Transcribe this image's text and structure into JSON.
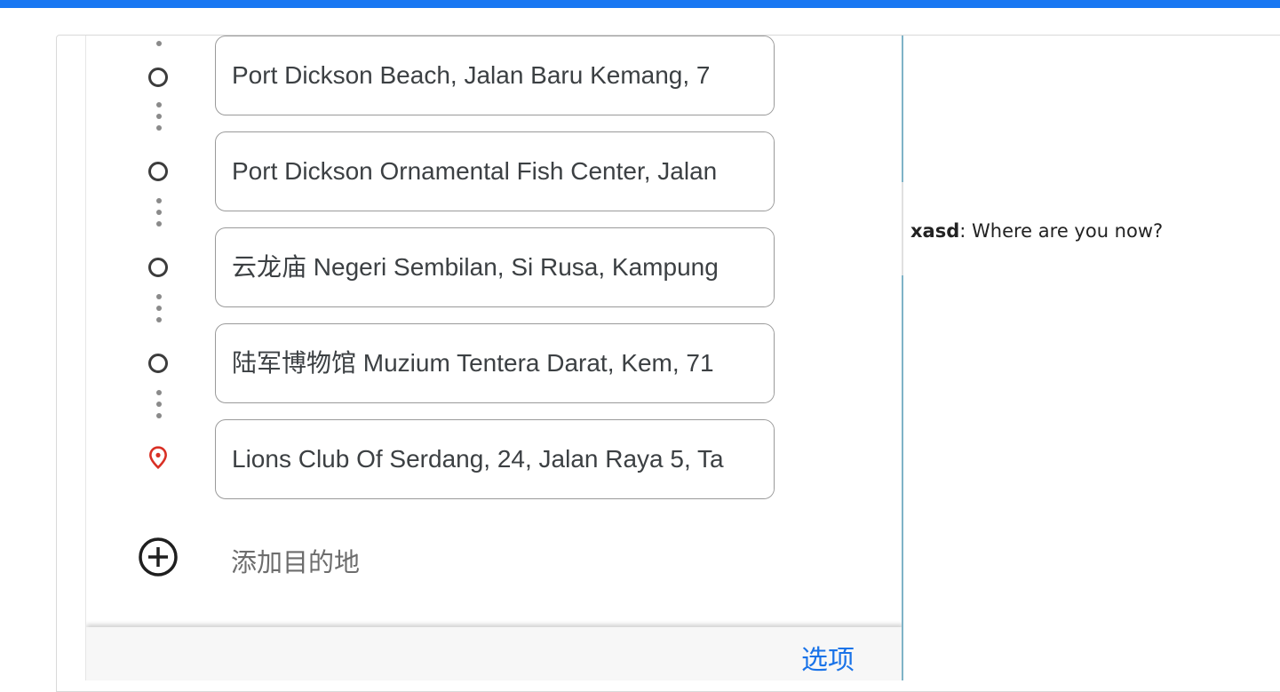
{
  "stops": [
    {
      "text": "Port Dickson Beach, Jalan Baru Kemang, 7",
      "type": "waypoint"
    },
    {
      "text": "Port Dickson Ornamental Fish Center, Jalan",
      "type": "waypoint"
    },
    {
      "text": "云龙庙 Negeri Sembilan, Si Rusa, Kampung",
      "type": "waypoint"
    },
    {
      "text": "陆军博物馆 Muzium Tentera Darat, Kem, 71",
      "type": "waypoint"
    },
    {
      "text": "Lions Club Of Serdang, 24, Jalan Raya 5, Ta",
      "type": "destination"
    }
  ],
  "add_destination": {
    "label": "添加目的地"
  },
  "options": {
    "label": "选项"
  },
  "chat": {
    "sender": "xasd",
    "separator": ": ",
    "message": "Where are you now?"
  },
  "colors": {
    "topbar": "#1877f2",
    "destination_pin": "#d93025",
    "options_link": "#1a73e8"
  },
  "icons": {
    "waypoint": "circle-outline-icon",
    "destination": "map-pin-icon",
    "add": "plus-circle-icon"
  }
}
